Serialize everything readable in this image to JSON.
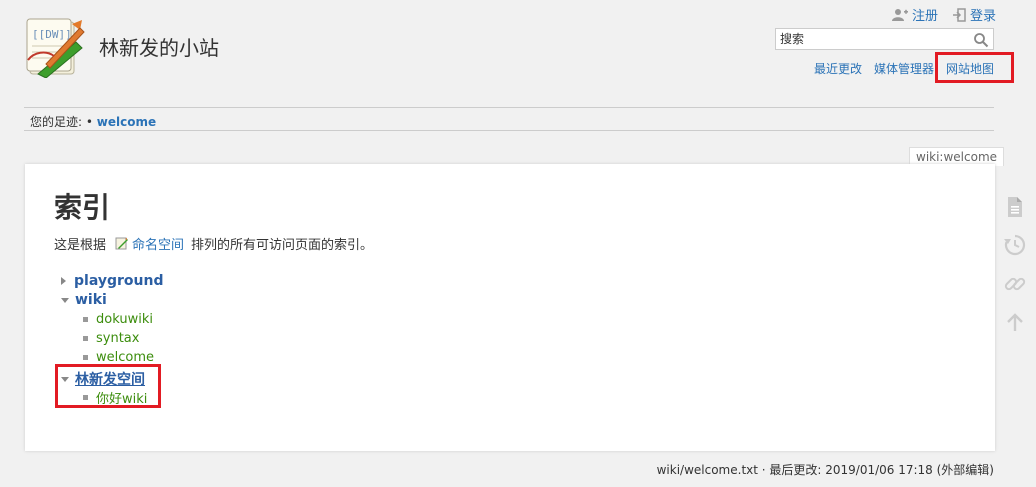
{
  "header": {
    "site_title": "林新发的小站",
    "user_tools": [
      {
        "label": "注册",
        "icon": "user-add-icon"
      },
      {
        "label": "登录",
        "icon": "login-icon"
      }
    ],
    "search": {
      "placeholder": "搜索"
    },
    "site_tools": [
      "最近更改",
      "媒体管理器",
      "网站地图"
    ]
  },
  "breadcrumbs": {
    "label": "您的足迹:",
    "sep": "•",
    "items": [
      "welcome"
    ]
  },
  "page": {
    "id_tab": "wiki:welcome",
    "title": "索引",
    "intro_prefix": "这是根据",
    "intro_link": "命名空间",
    "intro_suffix": "排列的所有可访问页面的索引。",
    "tree": [
      {
        "label": "playground",
        "type": "namespace",
        "state": "collapsed"
      },
      {
        "label": "wiki",
        "type": "namespace",
        "state": "expanded",
        "children": [
          "dokuwiki",
          "syntax",
          "welcome"
        ]
      },
      {
        "label": "林新发空间",
        "type": "namespace",
        "state": "expanded",
        "children": [
          "你好wiki"
        ]
      }
    ]
  },
  "page_tools": [
    "page-source-icon",
    "history-icon",
    "backlinks-icon",
    "back-to-top-icon"
  ],
  "footer": {
    "doc_info": "wiki/welcome.txt · 最后更改: 2019/01/06 17:18 (外部编辑)"
  },
  "colors": {
    "link": "#2b73b7",
    "namespace": "#2b5ea3",
    "page_link": "#3c8d0d",
    "highlight": "#e21b23"
  }
}
